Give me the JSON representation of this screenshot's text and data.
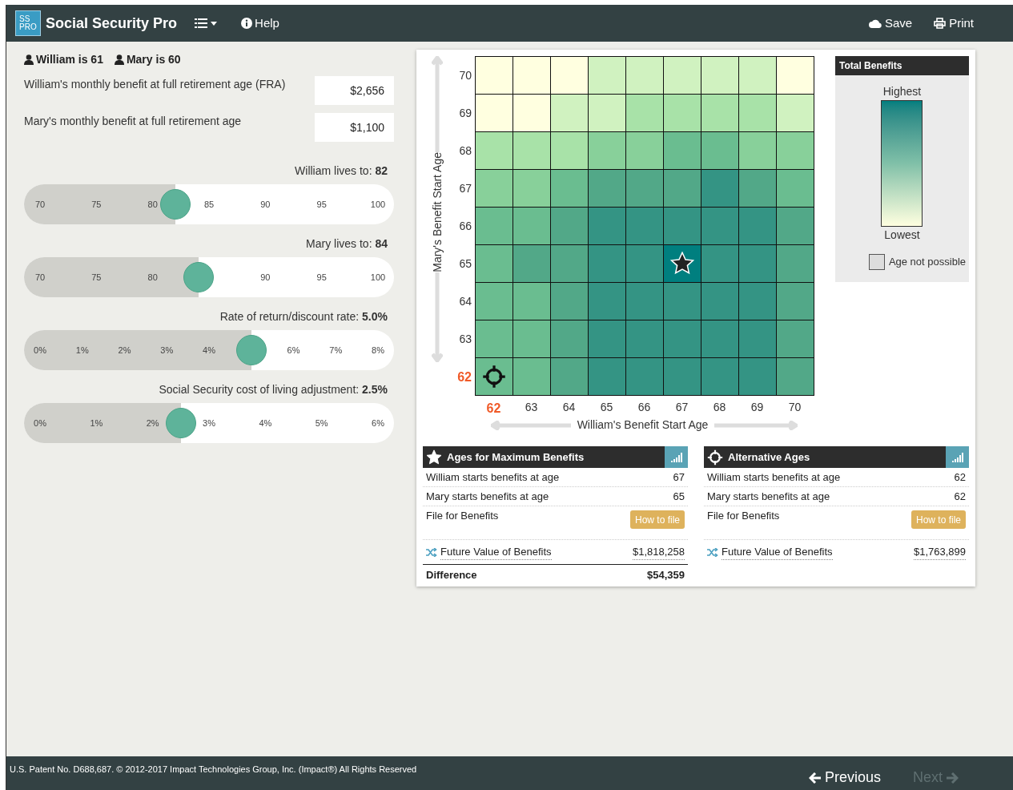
{
  "app": {
    "logo_top": "SS",
    "logo_bottom": "PRO",
    "title": "Social Security Pro",
    "help": "Help",
    "save": "Save",
    "print": "Print"
  },
  "people": [
    {
      "label": "William is 61"
    },
    {
      "label": "Mary is 60"
    }
  ],
  "benefits": [
    {
      "label": "William's monthly benefit at full retirement age (FRA)",
      "value": "$2,656"
    },
    {
      "label": "Mary's monthly benefit at full retirement age",
      "value": "$1,100"
    }
  ],
  "sliders": [
    {
      "label": "William lives to: **82**",
      "ticks": [
        "70",
        "75",
        "80",
        "85",
        "90",
        "95",
        "100"
      ],
      "level": 0.4
    },
    {
      "label": "Mary lives to: **84**",
      "ticks": [
        "70",
        "75",
        "80",
        "90",
        "95",
        "100"
      ],
      "level": 0.47
    },
    {
      "label": "Rate of return/discount rate: **5.0%**",
      "ticks": [
        "0%",
        "1%",
        "2%",
        "3%",
        "4%",
        "6%",
        "7%",
        "8%"
      ],
      "level": 0.625
    },
    {
      "label": "Social Security cost of living adjustment: **2.5%**",
      "ticks": [
        "0%",
        "1%",
        "2%",
        "3%",
        "4%",
        "5%",
        "6%"
      ],
      "level": 0.417
    }
  ],
  "heatmap": {
    "y_axis_label": "Mary's Benefit Start Age",
    "x_axis_label": "William's Benefit Start Age",
    "columns": [
      {
        "label": "62",
        "highlighted": true
      },
      {
        "label": "63",
        "highlighted": false
      },
      {
        "label": "64",
        "highlighted": false
      },
      {
        "label": "65",
        "highlighted": false
      },
      {
        "label": "66",
        "highlighted": false
      },
      {
        "label": "67",
        "highlighted": false
      },
      {
        "label": "68",
        "highlighted": false
      },
      {
        "label": "69",
        "highlighted": false
      },
      {
        "label": "70",
        "highlighted": false
      }
    ],
    "rows": [
      {
        "label": "70",
        "highlighted": false,
        "cells": [
          {
            "color": "#ffffe0"
          },
          {
            "color": "#ffffe0"
          },
          {
            "color": "#ffffe0"
          },
          {
            "color": "#d0f2c0"
          },
          {
            "color": "#d0f2c0"
          },
          {
            "color": "#d0f2c0"
          },
          {
            "color": "#d0f2c0"
          },
          {
            "color": "#d0f2c0"
          },
          {
            "color": "#ffffe0"
          }
        ]
      },
      {
        "label": "69",
        "highlighted": false,
        "cells": [
          {
            "color": "#ffffe0"
          },
          {
            "color": "#ffffe0"
          },
          {
            "color": "#d0f2c0"
          },
          {
            "color": "#d0f2c0"
          },
          {
            "color": "#a8e2a8"
          },
          {
            "color": "#a8e2a8"
          },
          {
            "color": "#a8e2a8"
          },
          {
            "color": "#a8e2a8"
          },
          {
            "color": "#d0f2c0"
          }
        ]
      },
      {
        "label": "68",
        "highlighted": false,
        "cells": [
          {
            "color": "#a8e2a8"
          },
          {
            "color": "#a8e2a8"
          },
          {
            "color": "#a8e2a8"
          },
          {
            "color": "#88d09a"
          },
          {
            "color": "#88d09a"
          },
          {
            "color": "#6abd90"
          },
          {
            "color": "#6abd90"
          },
          {
            "color": "#88d09a"
          },
          {
            "color": "#88d09a"
          }
        ]
      },
      {
        "label": "67",
        "highlighted": false,
        "cells": [
          {
            "color": "#88d09a"
          },
          {
            "color": "#88d09a"
          },
          {
            "color": "#6abd90"
          },
          {
            "color": "#52a888"
          },
          {
            "color": "#52a888"
          },
          {
            "color": "#52a888"
          },
          {
            "color": "#349484"
          },
          {
            "color": "#52a888"
          },
          {
            "color": "#6abd90"
          }
        ]
      },
      {
        "label": "66",
        "highlighted": false,
        "cells": [
          {
            "color": "#6abd90"
          },
          {
            "color": "#6abd90"
          },
          {
            "color": "#52a888"
          },
          {
            "color": "#349484"
          },
          {
            "color": "#349484"
          },
          {
            "color": "#349484"
          },
          {
            "color": "#349484"
          },
          {
            "color": "#349484"
          },
          {
            "color": "#52a888"
          }
        ]
      },
      {
        "label": "65",
        "highlighted": false,
        "cells": [
          {
            "color": "#6abd90"
          },
          {
            "color": "#52a888"
          },
          {
            "color": "#52a888"
          },
          {
            "color": "#349484"
          },
          {
            "color": "#349484"
          },
          {
            "color": "#007f7f",
            "kind": "optimal"
          },
          {
            "color": "#349484"
          },
          {
            "color": "#349484"
          },
          {
            "color": "#52a888"
          }
        ]
      },
      {
        "label": "64",
        "highlighted": false,
        "cells": [
          {
            "color": "#6abd90"
          },
          {
            "color": "#6abd90"
          },
          {
            "color": "#52a888"
          },
          {
            "color": "#349484"
          },
          {
            "color": "#349484"
          },
          {
            "color": "#349484"
          },
          {
            "color": "#349484"
          },
          {
            "color": "#349484"
          },
          {
            "color": "#52a888"
          }
        ]
      },
      {
        "label": "63",
        "highlighted": false,
        "cells": [
          {
            "color": "#6abd90"
          },
          {
            "color": "#6abd90"
          },
          {
            "color": "#52a888"
          },
          {
            "color": "#349484"
          },
          {
            "color": "#349484"
          },
          {
            "color": "#349484"
          },
          {
            "color": "#349484"
          },
          {
            "color": "#349484"
          },
          {
            "color": "#52a888"
          }
        ]
      },
      {
        "label": "62",
        "highlighted": true,
        "cells": [
          {
            "color": "#6abd90",
            "kind": "alternative"
          },
          {
            "color": "#6abd90"
          },
          {
            "color": "#52a888"
          },
          {
            "color": "#349484"
          },
          {
            "color": "#349484"
          },
          {
            "color": "#349484"
          },
          {
            "color": "#349484"
          },
          {
            "color": "#349484"
          },
          {
            "color": "#52a888"
          }
        ]
      }
    ]
  },
  "legend": {
    "title": "Total Benefits",
    "high": "Highest",
    "low": "Lowest",
    "not_possible": "Age not possible"
  },
  "panels": [
    {
      "kind": "optimal",
      "title": "Ages for Maximum Benefits",
      "rows": [
        {
          "label": "William starts benefits at age",
          "value": "67"
        },
        {
          "label": "Mary starts benefits at age",
          "value": "65"
        }
      ],
      "file_label": "File for Benefits",
      "file_button": "How to file",
      "future_label": "Future Value of Benefits",
      "future_value": "$1,818,258",
      "difference": {
        "label": "Difference",
        "value": "$54,359"
      }
    },
    {
      "kind": "alternative",
      "title": "Alternative Ages",
      "rows": [
        {
          "label": "William starts benefits at age",
          "value": "62"
        },
        {
          "label": "Mary starts benefits at age",
          "value": "62"
        }
      ],
      "file_label": "File for Benefits",
      "file_button": "How to file",
      "future_label": "Future Value of Benefits",
      "future_value": "$1,763,899"
    }
  ],
  "footer": {
    "copyright": "U.S. Patent No. D688,687. © 2012-2017 Impact Technologies Group, Inc. (Impact®) All Rights Reserved",
    "previous": "Previous",
    "next": "Next",
    "next_disabled": true
  }
}
